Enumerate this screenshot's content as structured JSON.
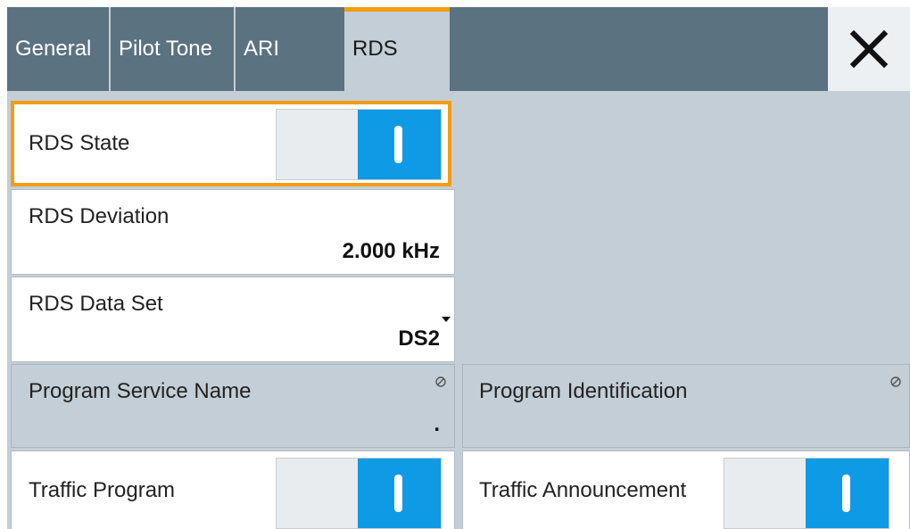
{
  "tabs": [
    {
      "label": "General"
    },
    {
      "label": "Pilot Tone"
    },
    {
      "label": "ARI"
    },
    {
      "label": "RDS",
      "active": true
    }
  ],
  "close_icon": "close-icon",
  "rds_state": {
    "label": "RDS State",
    "on": true
  },
  "rds_deviation": {
    "label": "RDS Deviation",
    "value": "2.000 kHz"
  },
  "rds_data_set": {
    "label": "RDS Data Set",
    "value": "DS2"
  },
  "program_service_name": {
    "label": "Program Service Name",
    "value": "."
  },
  "program_identification": {
    "label": "Program Identification",
    "value": ""
  },
  "traffic_program": {
    "label": "Traffic Program",
    "on": true
  },
  "traffic_announcement": {
    "label": "Traffic Announcement",
    "on": true
  },
  "colors": {
    "tab_bar": "#5b7280",
    "panel": "#c3ced6",
    "accent_focus": "#f39c12",
    "toggle_on": "#0f9ae6"
  }
}
